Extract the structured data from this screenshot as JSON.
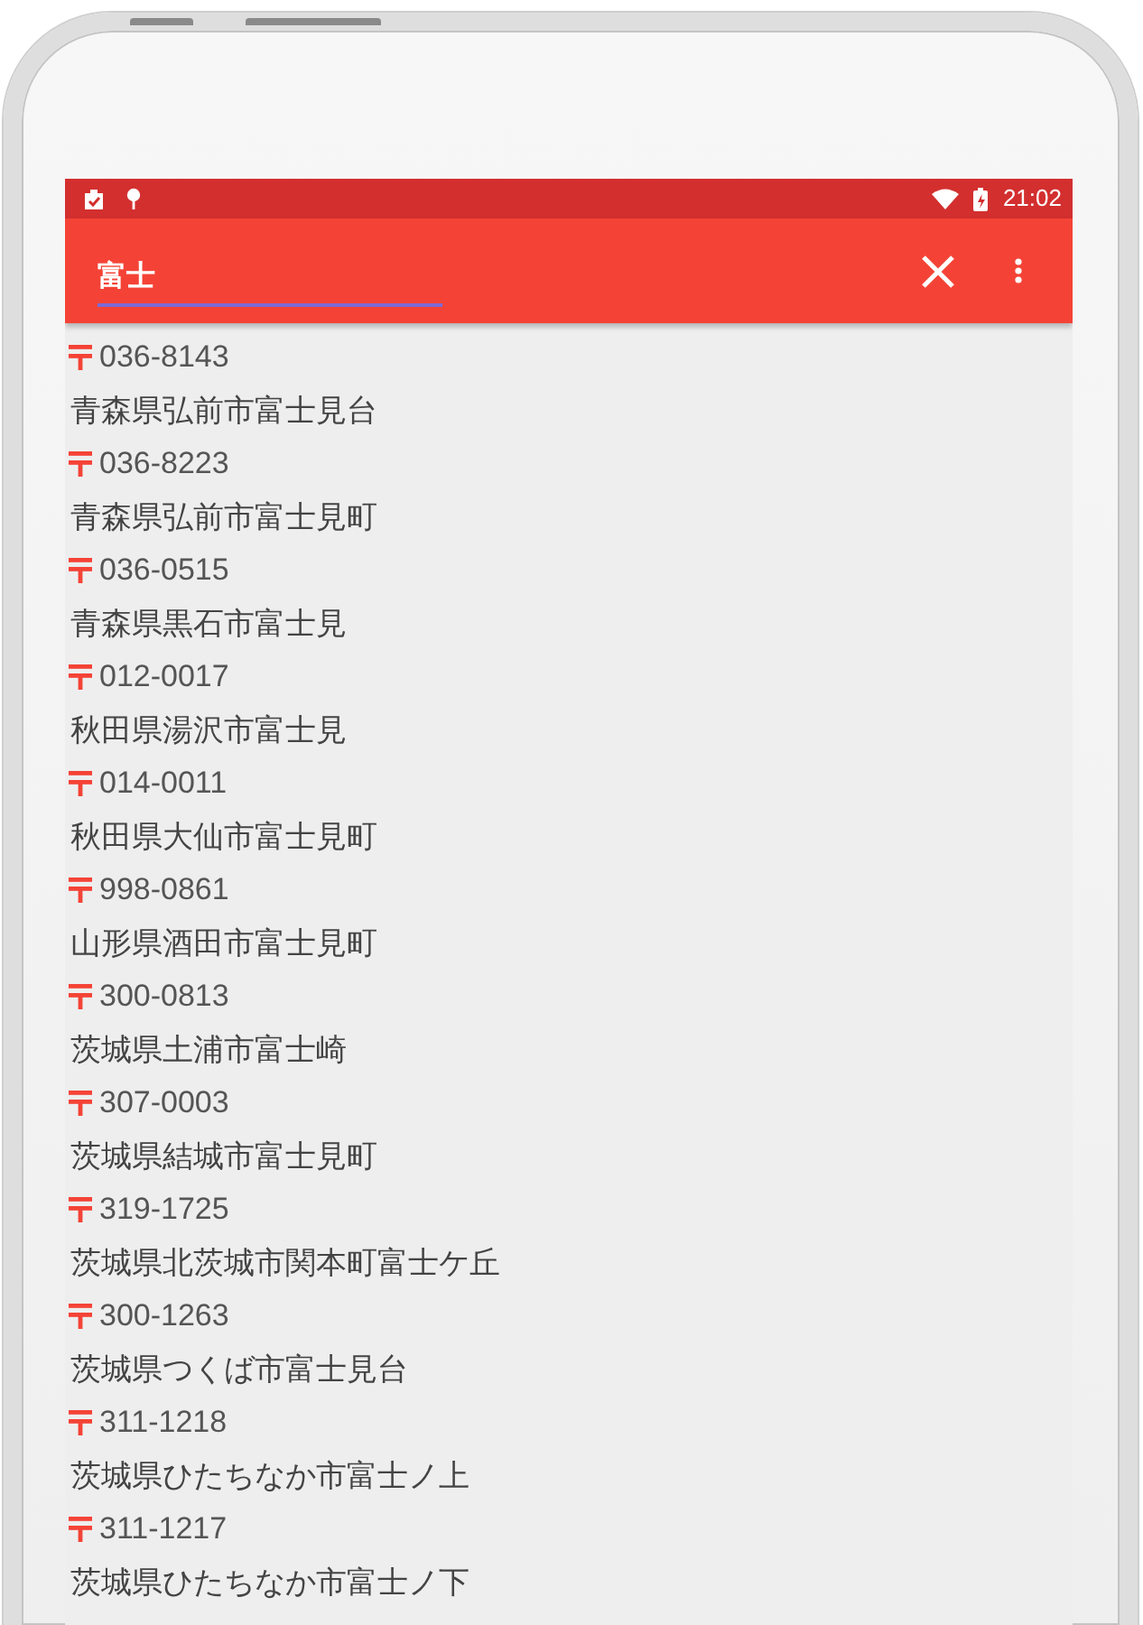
{
  "status_bar": {
    "time": "21:02"
  },
  "search": {
    "value": "富士"
  },
  "results": [
    {
      "postal_code": "036-8143",
      "address": "青森県弘前市富士見台"
    },
    {
      "postal_code": "036-8223",
      "address": "青森県弘前市富士見町"
    },
    {
      "postal_code": "036-0515",
      "address": "青森県黒石市富士見"
    },
    {
      "postal_code": "012-0017",
      "address": "秋田県湯沢市富士見"
    },
    {
      "postal_code": "014-0011",
      "address": "秋田県大仙市富士見町"
    },
    {
      "postal_code": "998-0861",
      "address": "山形県酒田市富士見町"
    },
    {
      "postal_code": "300-0813",
      "address": "茨城県土浦市富士崎"
    },
    {
      "postal_code": "307-0003",
      "address": "茨城県結城市富士見町"
    },
    {
      "postal_code": "319-1725",
      "address": "茨城県北茨城市関本町富士ケ丘"
    },
    {
      "postal_code": "300-1263",
      "address": "茨城県つくば市富士見台"
    },
    {
      "postal_code": "311-1218",
      "address": "茨城県ひたちなか市富士ノ上"
    },
    {
      "postal_code": "311-1217",
      "address": "茨城県ひたちなか市富士ノ下"
    }
  ]
}
